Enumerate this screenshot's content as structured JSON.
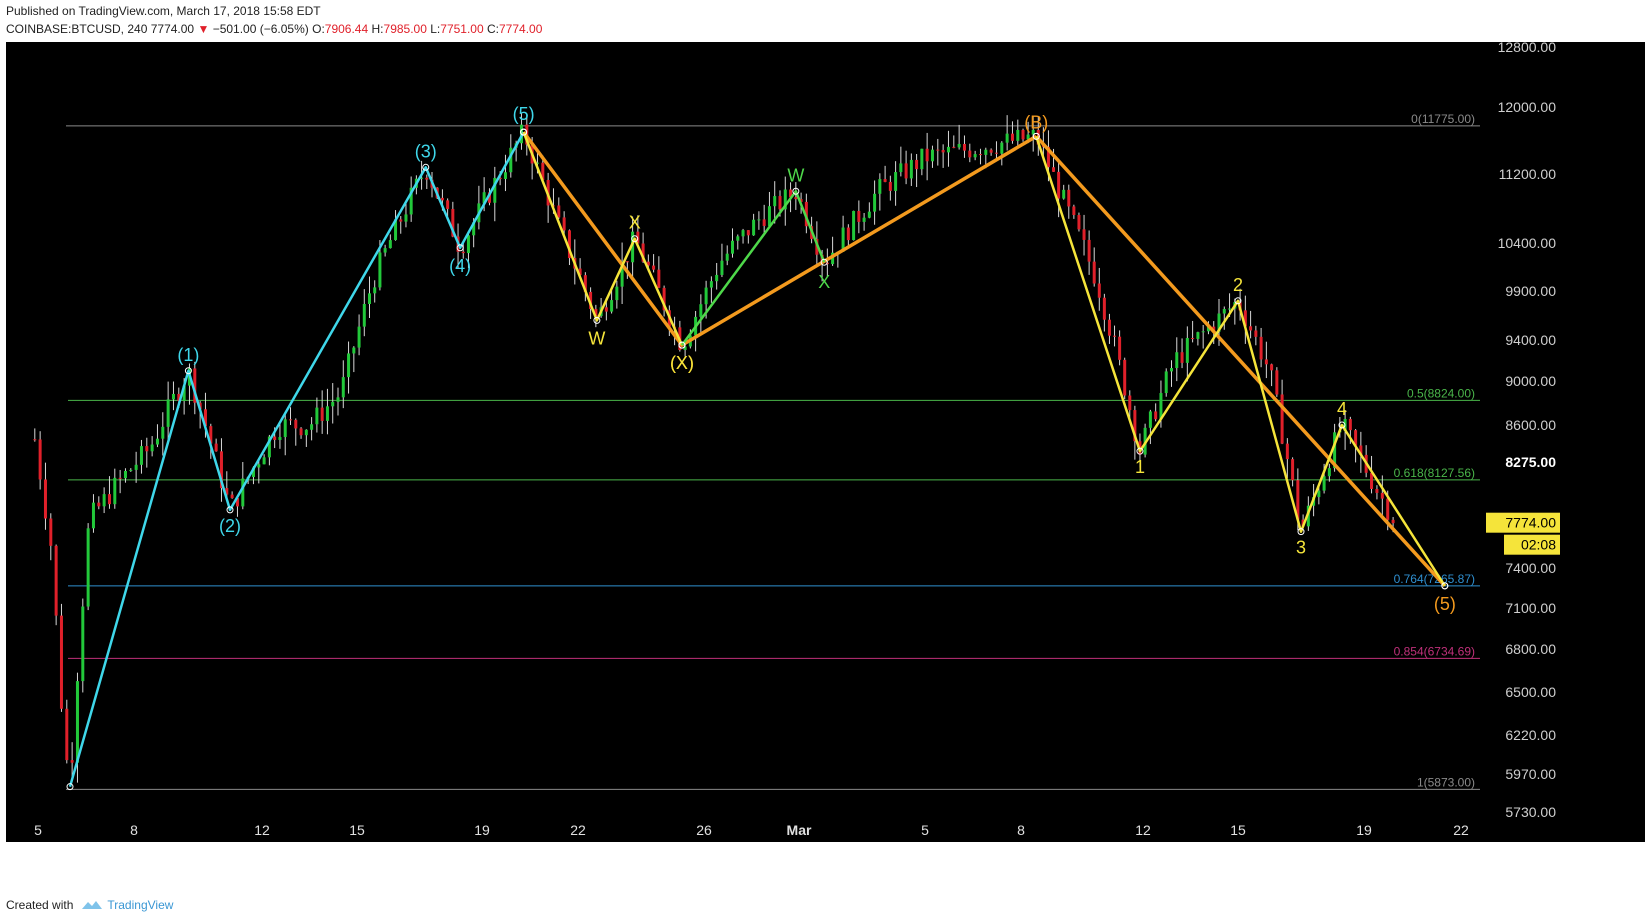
{
  "header": {
    "published": "Published on TradingView.com, March 17, 2018 15:58 EDT",
    "symbol": "COINBASE:BTCUSD, 240",
    "last": "7774.00",
    "change_icon": "down-triangle-icon",
    "change": "−501.00 (−6.05%)",
    "o_label": "O:",
    "o": "7906.44",
    "h_label": "H:",
    "h": "7985.00",
    "l_label": "L:",
    "l": "7751.00",
    "c_label": "C:",
    "c": "7774.00"
  },
  "footer": {
    "created_with": "Created with",
    "brand": "TradingView",
    "logo_icon": "tradingview-logo-icon"
  },
  "colors": {
    "background": "#000000",
    "up": "#22c83a",
    "down": "#e0202a",
    "impulse_cyan": "#3fd7ea",
    "correction_orange": "#f39a1e",
    "subwave_yellow": "#f5e43a",
    "subwave_green": "#4ed84a",
    "fib_gray": "#8a8a8a",
    "fib_green": "#4ab54a",
    "fib_blue": "#2f8fd0",
    "fib_magenta": "#c0307a",
    "price_tag": "#f5e43a"
  },
  "chart_data": {
    "type": "candlestick",
    "title": "COINBASE:BTCUSD, 240",
    "x_ticks": [
      "5",
      "8",
      "12",
      "15",
      "19",
      "22",
      "26",
      "Mar",
      "5",
      "8",
      "12",
      "15",
      "19",
      "22"
    ],
    "y_ticks": [
      "12800.00",
      "12000.00",
      "11200.00",
      "10400.00",
      "9900.00",
      "9400.00",
      "9000.00",
      "8600.00",
      "8275.00",
      "7400.00",
      "7100.00",
      "6800.00",
      "6500.00",
      "6220.00",
      "5970.00",
      "5730.00"
    ],
    "current_price": "7774.00",
    "countdown": "02:08",
    "fib_levels": [
      {
        "label": "0(11775.00)",
        "value": 11775,
        "color": "gray"
      },
      {
        "label": "0.5(8824.00)",
        "value": 8824,
        "color": "green"
      },
      {
        "label": "0.618(8127.56)",
        "value": 8127.56,
        "color": "green"
      },
      {
        "label": "0.764(7265.87)",
        "value": 7265.87,
        "color": "blue"
      },
      {
        "label": "0.854(6734.69)",
        "value": 6734.69,
        "color": "magenta"
      },
      {
        "label": "1(5873.00)",
        "value": 5873,
        "color": "gray"
      }
    ],
    "waves": [
      {
        "name": "impulse",
        "color": "cyan",
        "points": [
          {
            "x": 6.0,
            "y": 5890
          },
          {
            "x": 9.7,
            "y": 9100
          },
          {
            "x": 11.0,
            "y": 7880
          },
          {
            "x": 17.2,
            "y": 11280
          },
          {
            "x": 18.3,
            "y": 10350
          },
          {
            "x": 20.3,
            "y": 11700
          }
        ],
        "labels": [
          "(1)",
          "(2)",
          "(3)",
          "(4)",
          "(5)"
        ]
      },
      {
        "name": "correction-a",
        "color": "orange",
        "points": [
          {
            "x": 20.3,
            "y": 11700
          },
          {
            "x": 25.3,
            "y": 9350
          },
          {
            "x": 36.5,
            "y": 11650
          }
        ],
        "labels": [
          "(X)",
          "(B)"
        ]
      },
      {
        "name": "correction-b",
        "color": "orange",
        "points": [
          {
            "x": 36.5,
            "y": 11650
          },
          {
            "x": 49.5,
            "y": 7266
          }
        ],
        "labels": [
          "(5)"
        ]
      },
      {
        "name": "wxy-yellow",
        "color": "yellow",
        "points": [
          {
            "x": 20.3,
            "y": 11700
          },
          {
            "x": 22.6,
            "y": 9600
          },
          {
            "x": 23.8,
            "y": 10450
          },
          {
            "x": 25.3,
            "y": 9350
          }
        ],
        "labels": [
          "W",
          "X",
          "(X)"
        ]
      },
      {
        "name": "wxy-green",
        "color": "green",
        "points": [
          {
            "x": 25.3,
            "y": 9350
          },
          {
            "x": 28.9,
            "y": 11000
          },
          {
            "x": 29.8,
            "y": 10200
          }
        ],
        "labels": [
          "W",
          "X"
        ]
      },
      {
        "name": "five-wave-down",
        "color": "yellow",
        "points": [
          {
            "x": 36.5,
            "y": 11650
          },
          {
            "x": 39.9,
            "y": 8370
          },
          {
            "x": 43.0,
            "y": 9800
          },
          {
            "x": 45.0,
            "y": 7700
          },
          {
            "x": 46.3,
            "y": 8600
          },
          {
            "x": 49.5,
            "y": 7266
          }
        ],
        "labels": [
          "1",
          "2",
          "3",
          "4"
        ]
      }
    ]
  }
}
